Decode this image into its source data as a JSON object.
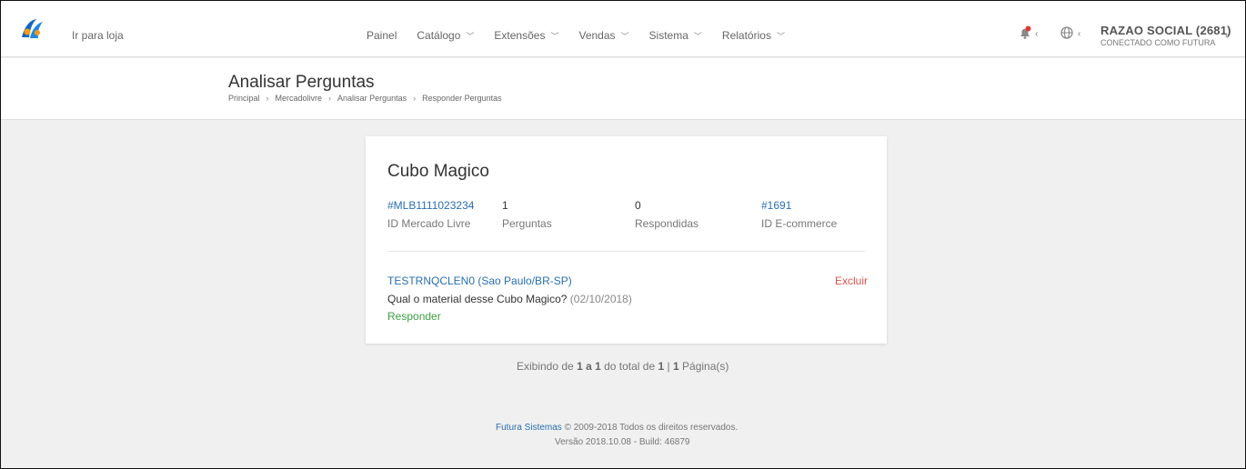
{
  "topbar": {
    "store_link": "Ir para loja",
    "nav": [
      {
        "label": "Painel",
        "has_dropdown": false
      },
      {
        "label": "Catálogo",
        "has_dropdown": true
      },
      {
        "label": "Extensões",
        "has_dropdown": true
      },
      {
        "label": "Vendas",
        "has_dropdown": true
      },
      {
        "label": "Sistema",
        "has_dropdown": true
      },
      {
        "label": "Relatórios",
        "has_dropdown": true
      }
    ],
    "user_name": "RAZAO SOCIAL (2681)",
    "user_sub": "CONECTADO COMO FUTURA",
    "notification_color": "#e53935"
  },
  "page": {
    "title": "Analisar Perguntas",
    "breadcrumb": [
      "Principal",
      "Mercadolivre",
      "Analisar Perguntas",
      "Responder Perguntas"
    ]
  },
  "product": {
    "title": "Cubo Magico",
    "stats": [
      {
        "value": "#MLB1111023234",
        "label": "ID Mercado Livre",
        "link": true
      },
      {
        "value": "1",
        "label": "Perguntas",
        "link": false
      },
      {
        "value": "0",
        "label": "Respondidas",
        "link": false
      },
      {
        "value": "#1691",
        "label": "ID E-commerce",
        "link": true
      }
    ]
  },
  "question": {
    "asker": "TESTRNQCLEN0 (Sao Paulo/BR-SP)",
    "delete_label": "Excluir",
    "text": "Qual o material desse Cubo Magico?",
    "date": "(02/10/2018)",
    "reply_label": "Responder"
  },
  "paging": {
    "prefix": "Exibindo de",
    "range": "1 a 1",
    "mid": "do total de",
    "total": "1",
    "sep": "|",
    "pages": "1",
    "suffix": "Página(s)"
  },
  "footer": {
    "company": "Futura Sistemas",
    "copyright": "© 2009-2018 Todos os direitos reservados.",
    "version": "Versão 2018.10.08 - Build: 46879"
  },
  "colors": {
    "link": "#2a6fb0",
    "danger": "#d9534f",
    "success": "#3ca042",
    "logo_blue": "#1565c0",
    "logo_orange": "#f39c12"
  }
}
